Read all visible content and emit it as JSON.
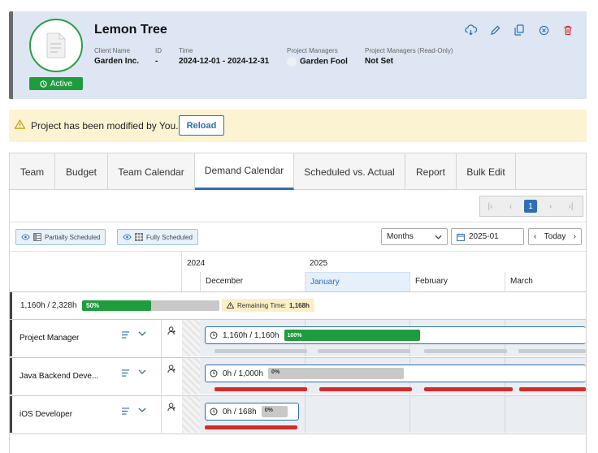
{
  "project": {
    "name": "Lemon Tree",
    "status": "Active",
    "client_label": "Client Name",
    "client": "Garden Inc.",
    "id_label": "ID",
    "id": "-",
    "time_label": "Time",
    "time": "2024-12-01 - 2024-12-31",
    "pm_label": "Project Managers",
    "pm": "Garden Fool",
    "pm_ro_label": "Project Managers (Read-Only)",
    "pm_ro": "Not Set"
  },
  "header_actions": [
    "cloud-sync-icon",
    "edit-icon",
    "copy-icon",
    "cancel-icon",
    "delete-icon"
  ],
  "banner": {
    "message": "Project has been modified by You.",
    "reload": "Reload"
  },
  "tabs": [
    {
      "label": "Team"
    },
    {
      "label": "Budget"
    },
    {
      "label": "Team Calendar"
    },
    {
      "label": "Demand Calendar",
      "active": true
    },
    {
      "label": "Scheduled vs. Actual"
    },
    {
      "label": "Report"
    },
    {
      "label": "Bulk Edit"
    }
  ],
  "pagination": {
    "current": "1"
  },
  "filters": {
    "partial": "Partially Scheduled",
    "full": "Fully Scheduled"
  },
  "view": {
    "mode": "Months",
    "date": "2025-01",
    "today": "Today"
  },
  "timeline": {
    "years": [
      "2024",
      "2025"
    ],
    "months": [
      "December",
      "January",
      "February",
      "March"
    ]
  },
  "summary": {
    "hours": "1,160h / 2,328h",
    "percent_label": "50%",
    "percent": 50,
    "remaining_label": "Remaining Time:",
    "remaining": "1,168h"
  },
  "rows": [
    {
      "role": "Project Manager",
      "hours": "1,160h / 1,160h",
      "percent_label": "100%",
      "percent": 100
    },
    {
      "role": "Java Backend Deve...",
      "hours": "0h / 1,000h",
      "percent_label": "0%",
      "percent": 0
    },
    {
      "role": "iOS Developer",
      "hours": "0h / 168h",
      "percent_label": "0%",
      "percent": 0
    }
  ],
  "colors": {
    "accent": "#2e6fb3",
    "success": "#1f9d3e",
    "danger": "#d62b2b",
    "warning_bg": "#fcf3d3"
  }
}
